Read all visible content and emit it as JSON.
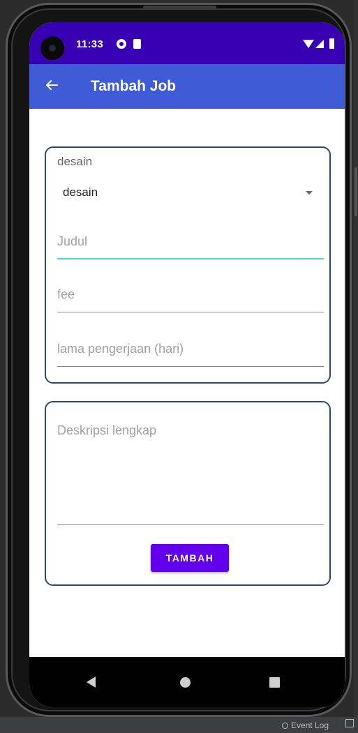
{
  "status_bar": {
    "time": "11:33",
    "icons": [
      "camera-cutout",
      "notification-icon",
      "sd-card-icon",
      "wifi-icon",
      "signal-icon",
      "battery-icon"
    ]
  },
  "app_bar": {
    "title": "Tambah Job",
    "back_icon": "arrow-left-icon",
    "background": "#3f5bd6"
  },
  "form": {
    "category_label": "desain",
    "category_selected": "desain",
    "judul_placeholder": "Judul",
    "fee_placeholder": "fee",
    "lama_placeholder": "lama pengerjaan (hari)",
    "deskripsi_placeholder": "Deskripsi lengkap",
    "submit_label": "TAMBAH"
  },
  "nav_bar": {
    "icons": [
      "nav-back-icon",
      "nav-home-icon",
      "nav-recents-icon"
    ]
  },
  "ide": {
    "event_log_label": "Event Log"
  },
  "colors": {
    "status_bar": "#3700b3",
    "accent": "#6200ee",
    "focus_underline": "#3cd9d3",
    "card_border": "#2b4a6b"
  }
}
